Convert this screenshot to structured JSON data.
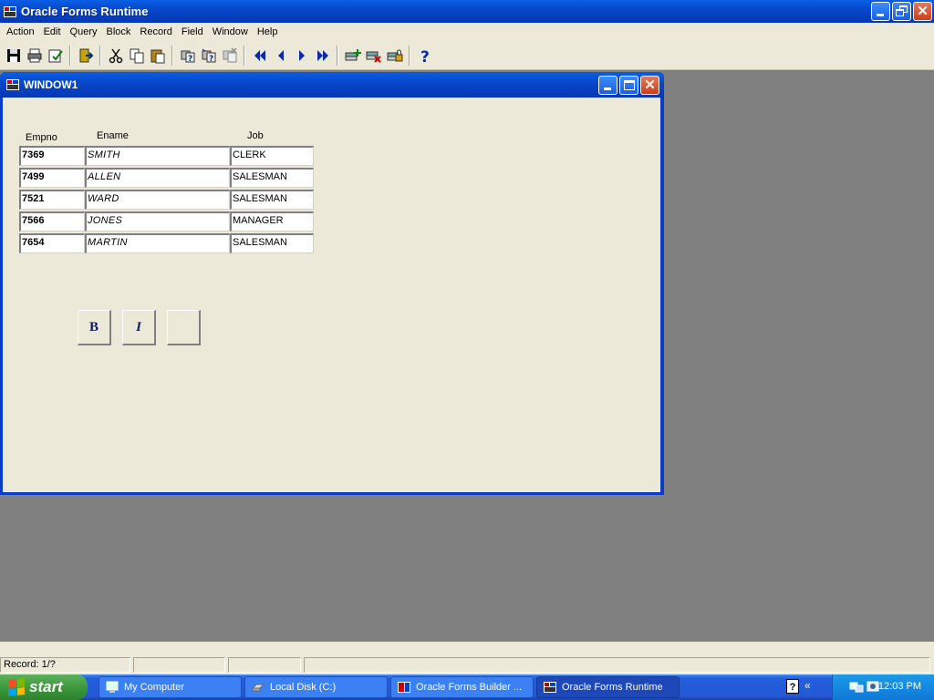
{
  "app": {
    "title": "Oracle Forms Runtime"
  },
  "menu": [
    "Action",
    "Edit",
    "Query",
    "Block",
    "Record",
    "Field",
    "Window",
    "Help"
  ],
  "toolbar": {
    "icons": [
      "save-icon",
      "print-icon",
      "clear-form-icon",
      "exit-icon",
      "cut-icon",
      "copy-icon",
      "paste-icon",
      "enter-query-icon",
      "execute-query-icon",
      "cancel-query-icon",
      "first-record-icon",
      "previous-record-icon",
      "next-record-icon",
      "last-record-icon",
      "insert-record-icon",
      "delete-record-icon",
      "lock-record-icon",
      "help-icon"
    ]
  },
  "window1": {
    "title": "WINDOW1",
    "columns": {
      "empno": "Empno",
      "ename": "Ename",
      "job": "Job"
    },
    "rows": [
      {
        "empno": "7369",
        "ename": "SMITH",
        "job": "CLERK"
      },
      {
        "empno": "7499",
        "ename": "ALLEN",
        "job": "SALESMAN"
      },
      {
        "empno": "7521",
        "ename": "WARD",
        "job": "SALESMAN"
      },
      {
        "empno": "7566",
        "ename": "JONES",
        "job": "MANAGER"
      },
      {
        "empno": "7654",
        "ename": "MARTIN",
        "job": "SALESMAN"
      }
    ],
    "buttons": {
      "bold": "B",
      "italic": "I",
      "blank": ""
    }
  },
  "status": {
    "record": "Record: 1/?"
  },
  "taskbar": {
    "start": "start",
    "tasks": [
      "My Computer",
      "Local Disk (C:)",
      "Oracle Forms Builder ...",
      "Oracle Forms Runtime"
    ],
    "clock": "12:03 PM"
  },
  "colors": {
    "title_blue": "#0846c8",
    "face": "#ece9d8",
    "desktop": "#808080",
    "start_green": "#3c9a3c"
  }
}
